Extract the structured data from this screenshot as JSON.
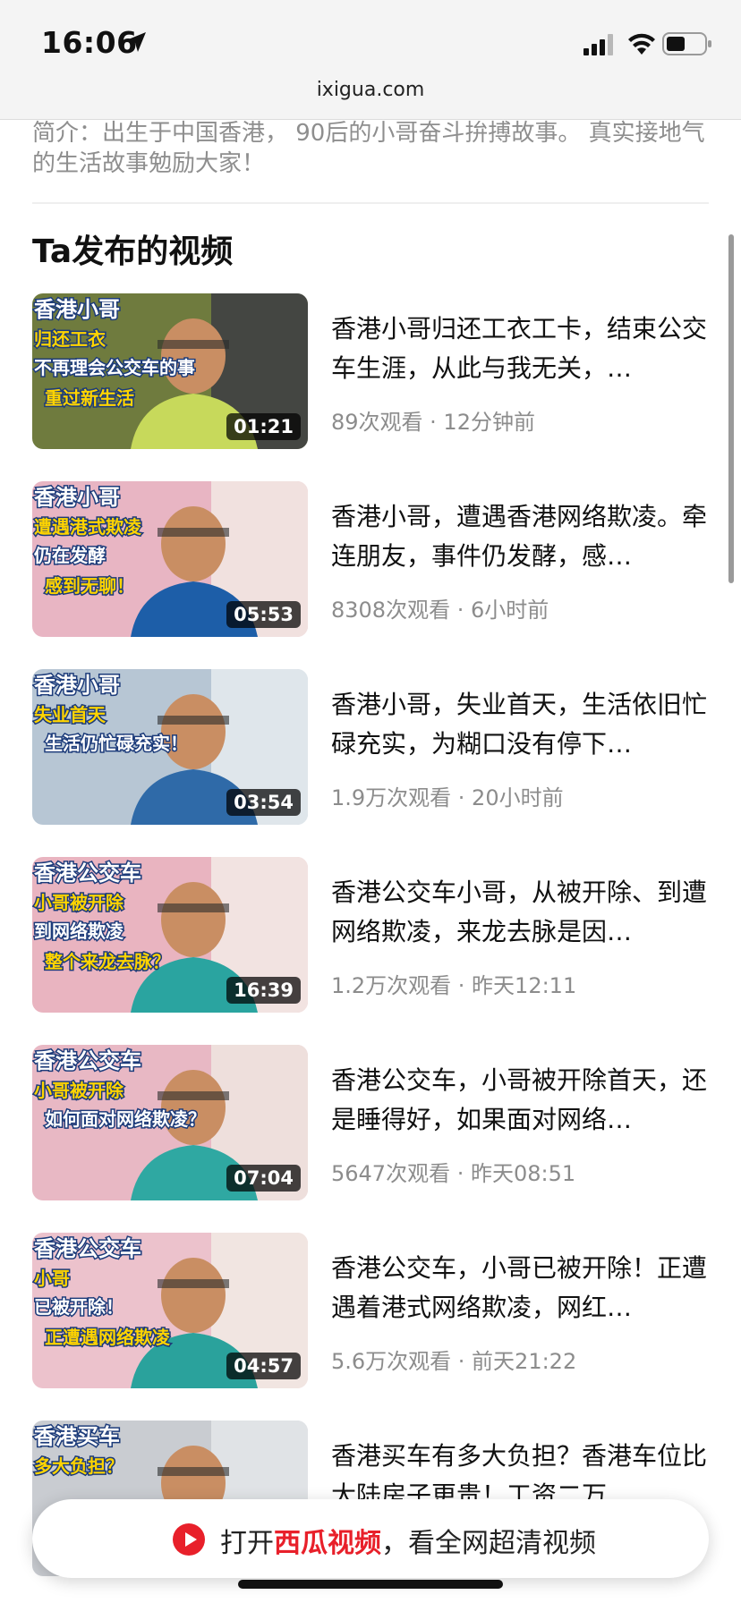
{
  "status_bar": {
    "time": "16:06",
    "icons": [
      "location-arrow-icon",
      "cellular-signal-icon",
      "wifi-icon",
      "battery-icon"
    ]
  },
  "browser": {
    "url": "ixigua.com"
  },
  "profile": {
    "intro": "简介：出生于中国香港， 90后的小哥奋斗拚搏故事。 真实接地气的生活故事勉励大家！"
  },
  "section": {
    "title": "Ta发布的视频"
  },
  "videos": [
    {
      "title": "香港小哥归还工衣工卡，结束公交车生涯，从此与我无关，…",
      "meta": "89次观看 · 12分钟前",
      "duration": "01:21",
      "thumb_text": [
        "香港小哥",
        "归还工衣",
        "不再理会公交车的事",
        "重过新生活"
      ],
      "thumb_colors": [
        "#6f7b3e",
        "#c7d95b",
        "#3a3a44"
      ]
    },
    {
      "title": "香港小哥，遭遇香港网络欺凌。牵连朋友，事件仍发酵，感…",
      "meta": "8308次观看 · 6小时前",
      "duration": "05:53",
      "thumb_text": [
        "香港小哥",
        "遭遇港式欺凌",
        "仍在发酵",
        "感到无聊！"
      ],
      "thumb_colors": [
        "#e8b5c3",
        "#1d5ea8",
        "#f3ece6"
      ]
    },
    {
      "title": "香港小哥，失业首天，生活依旧忙碌充实，为糊口没有停下…",
      "meta": "1.9万次观看 · 20小时前",
      "duration": "03:54",
      "thumb_text": [
        "香港小哥",
        "失业首天",
        "生活仍忙碌充实！"
      ],
      "thumb_colors": [
        "#b7c6d4",
        "#2f6aa8",
        "#e9edf0"
      ]
    },
    {
      "title": "香港公交车小哥，从被开除、到遭网络欺凌，来龙去脉是因…",
      "meta": "1.2万次观看 · 昨天12:11",
      "duration": "16:39",
      "thumb_text": [
        "香港公交车",
        "小哥被开除",
        "到网络欺凌",
        "整个来龙去脉？"
      ],
      "thumb_colors": [
        "#e9b4c0",
        "#2aa4a0",
        "#f4efe8"
      ]
    },
    {
      "title": "香港公交车，小哥被开除首天，还是睡得好，如果面对网络…",
      "meta": "5647次观看 · 昨天08:51",
      "duration": "07:04",
      "thumb_text": [
        "香港公交车",
        "小哥被开除",
        "如何面对网络欺凌？"
      ],
      "thumb_colors": [
        "#e8b8c4",
        "#2fa8a2",
        "#efe9e2"
      ]
    },
    {
      "title": "香港公交车，小哥已被开除！正遭遇着港式网络欺凌，网红…",
      "meta": "5.6万次观看 · 前天21:22",
      "duration": "04:57",
      "thumb_text": [
        "香港公交车",
        "小哥",
        "已被开除！",
        "正遭遇网络欺凌"
      ],
      "thumb_colors": [
        "#ecc2cc",
        "#2aa29c",
        "#f3ede6"
      ]
    },
    {
      "title": "香港买车有多大负担？香港车位比大陆房子更贵！工资二万…",
      "meta": "",
      "duration": "",
      "thumb_text": [
        "香港买车",
        "多大负担？"
      ],
      "thumb_colors": [
        "#c9ccd1",
        "#3d6db0",
        "#e6e8eb"
      ]
    }
  ],
  "open_app_banner": {
    "prefix": "打开",
    "brand": "西瓜视频",
    "suffix": "，看全网超清视频",
    "brand_color": "#e8202a",
    "icon": "xigua-play-icon"
  }
}
